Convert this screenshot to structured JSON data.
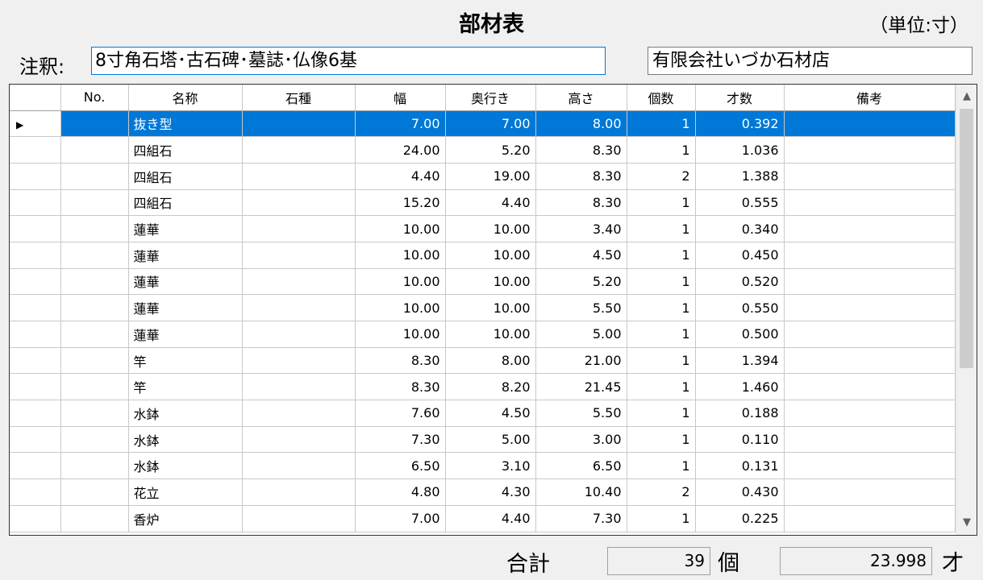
{
  "header": {
    "title": "部材表",
    "unit": "（単位:寸）"
  },
  "note": {
    "label": "注釈:",
    "value": "8寸角石塔･古石碑･墓誌･仏像6基"
  },
  "company": {
    "value": "有限会社いづか石材店"
  },
  "grid": {
    "columns": [
      "No.",
      "名称",
      "石種",
      "幅",
      "奥行き",
      "高さ",
      "個数",
      "才数",
      "備考"
    ],
    "rows": [
      {
        "no": "",
        "name": "抜き型",
        "stone": "",
        "width": "7.00",
        "depth": "7.00",
        "height": "8.00",
        "count": "1",
        "sai": "0.392",
        "note": ""
      },
      {
        "no": "",
        "name": "四組石",
        "stone": "",
        "width": "24.00",
        "depth": "5.20",
        "height": "8.30",
        "count": "1",
        "sai": "1.036",
        "note": ""
      },
      {
        "no": "",
        "name": "四組石",
        "stone": "",
        "width": "4.40",
        "depth": "19.00",
        "height": "8.30",
        "count": "2",
        "sai": "1.388",
        "note": ""
      },
      {
        "no": "",
        "name": "四組石",
        "stone": "",
        "width": "15.20",
        "depth": "4.40",
        "height": "8.30",
        "count": "1",
        "sai": "0.555",
        "note": ""
      },
      {
        "no": "",
        "name": "蓮華",
        "stone": "",
        "width": "10.00",
        "depth": "10.00",
        "height": "3.40",
        "count": "1",
        "sai": "0.340",
        "note": ""
      },
      {
        "no": "",
        "name": "蓮華",
        "stone": "",
        "width": "10.00",
        "depth": "10.00",
        "height": "4.50",
        "count": "1",
        "sai": "0.450",
        "note": ""
      },
      {
        "no": "",
        "name": "蓮華",
        "stone": "",
        "width": "10.00",
        "depth": "10.00",
        "height": "5.20",
        "count": "1",
        "sai": "0.520",
        "note": ""
      },
      {
        "no": "",
        "name": "蓮華",
        "stone": "",
        "width": "10.00",
        "depth": "10.00",
        "height": "5.50",
        "count": "1",
        "sai": "0.550",
        "note": ""
      },
      {
        "no": "",
        "name": "蓮華",
        "stone": "",
        "width": "10.00",
        "depth": "10.00",
        "height": "5.00",
        "count": "1",
        "sai": "0.500",
        "note": ""
      },
      {
        "no": "",
        "name": "竿",
        "stone": "",
        "width": "8.30",
        "depth": "8.00",
        "height": "21.00",
        "count": "1",
        "sai": "1.394",
        "note": ""
      },
      {
        "no": "",
        "name": "竿",
        "stone": "",
        "width": "8.30",
        "depth": "8.20",
        "height": "21.45",
        "count": "1",
        "sai": "1.460",
        "note": ""
      },
      {
        "no": "",
        "name": "水鉢",
        "stone": "",
        "width": "7.60",
        "depth": "4.50",
        "height": "5.50",
        "count": "1",
        "sai": "0.188",
        "note": ""
      },
      {
        "no": "",
        "name": "水鉢",
        "stone": "",
        "width": "7.30",
        "depth": "5.00",
        "height": "3.00",
        "count": "1",
        "sai": "0.110",
        "note": ""
      },
      {
        "no": "",
        "name": "水鉢",
        "stone": "",
        "width": "6.50",
        "depth": "3.10",
        "height": "6.50",
        "count": "1",
        "sai": "0.131",
        "note": ""
      },
      {
        "no": "",
        "name": "花立",
        "stone": "",
        "width": "4.80",
        "depth": "4.30",
        "height": "10.40",
        "count": "2",
        "sai": "0.430",
        "note": ""
      },
      {
        "no": "",
        "name": "香炉",
        "stone": "",
        "width": "7.00",
        "depth": "4.40",
        "height": "7.30",
        "count": "1",
        "sai": "0.225",
        "note": ""
      }
    ],
    "selected_row": 0,
    "row_indicator": "▶"
  },
  "totals": {
    "label": "合計",
    "count": "39",
    "count_unit": "個",
    "sai": "23.998",
    "sai_unit": "才"
  },
  "scrollbar": {
    "up_icon": "▲",
    "down_icon": "▼"
  },
  "colors": {
    "selection": "#0078d7",
    "background": "#f0f0f0"
  }
}
